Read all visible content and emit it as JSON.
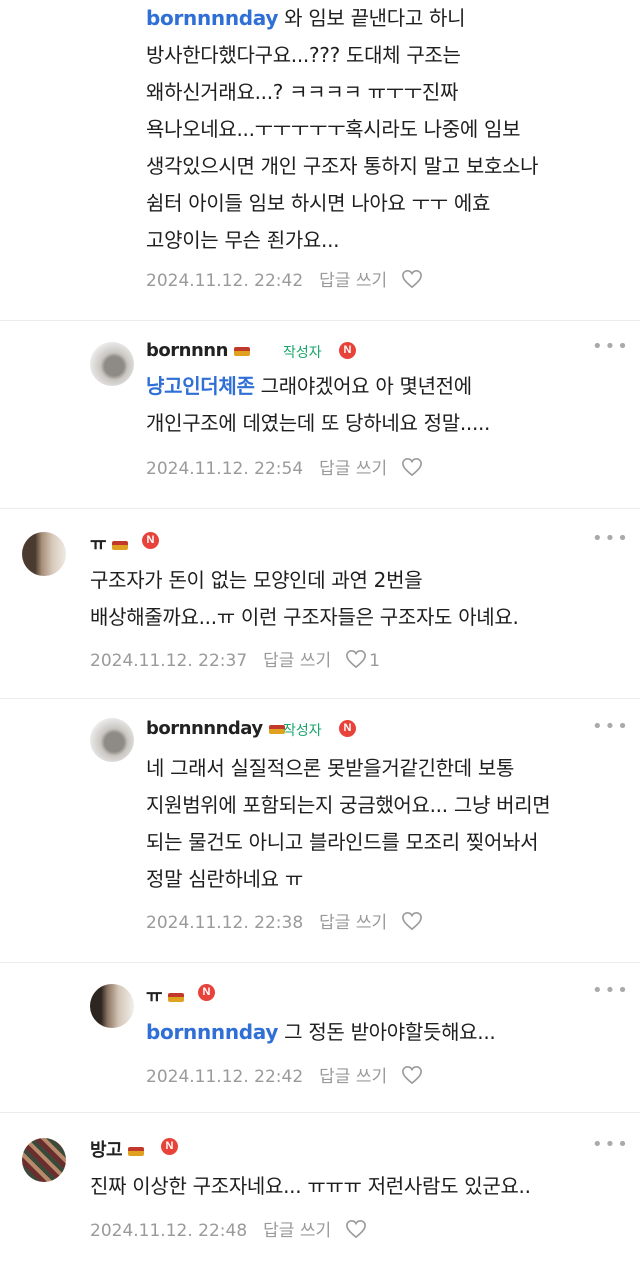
{
  "comments": [
    {
      "id": "c1",
      "mention": "bornnnnday",
      "text_first": " 와 임보 끝낸다고 하니",
      "lines": [
        "방사한다했다구요...??? 도대체 구조는",
        "왜하신거래요...? ㅋㅋㅋㅋ ㅠㅜㅜ진짜",
        "욕나오네요...ㅜㅜㅜㅜㅜ혹시라도 나중에 임보",
        "생각있으시면 개인 구조자 통하지 말고 보호소나",
        "쉼터 아이들 임보 하시면 나아요 ㅜㅜ 에효",
        "고양이는 무슨 죈가요..."
      ],
      "date": "2024.11.12. 22:42",
      "reply": "답글 쓰기",
      "likes": ""
    },
    {
      "id": "c2",
      "name": "bornnnn",
      "author_tag": "작성자",
      "badge": "N",
      "mention": "냥고인더체존",
      "text_first": " 그래야겠어요 아 몇년전에",
      "lines": [
        "개인구조에 데였는데 또 당하네요 정말....."
      ],
      "date": "2024.11.12. 22:54",
      "reply": "답글 쓰기",
      "likes": ""
    },
    {
      "id": "c3",
      "name": "ㅠ",
      "badge": "N",
      "lines": [
        "구조자가 돈이 없는 모양인데 과연 2번을",
        "배상해줄까요...ㅠ 이런 구조자들은 구조자도 아녜요."
      ],
      "date": "2024.11.12. 22:37",
      "reply": "답글 쓰기",
      "likes": "1"
    },
    {
      "id": "c4",
      "name": "bornnnnday",
      "author_tag": "작성자",
      "badge": "N",
      "lines": [
        "네 그래서 실질적으론 못받을거같긴한데 보통",
        "지원범위에 포함되는지 궁금했어요... 그냥 버리면",
        "되는 물건도 아니고 블라인드를 모조리 찢어놔서",
        "정말 심란하네요 ㅠ"
      ],
      "date": "2024.11.12. 22:38",
      "reply": "답글 쓰기",
      "likes": ""
    },
    {
      "id": "c5",
      "name": "ㅠ",
      "badge": "N",
      "mention": "bornnnnday",
      "text_first": " 그 정돈 받아야할듯해요...",
      "lines": [],
      "date": "2024.11.12. 22:42",
      "reply": "답글 쓰기",
      "likes": ""
    },
    {
      "id": "c6",
      "name": "방고",
      "badge": "N",
      "lines": [
        "진짜 이상한 구조자네요... ㅠㅠㅠ 저런사람도 있군요.."
      ],
      "date": "2024.11.12. 22:48",
      "reply": "답글 쓰기",
      "likes": ""
    }
  ],
  "colors": {
    "accent_green": "#1aa56a",
    "badge_red": "#e8433a",
    "mention_blue": "#2f6fd6",
    "meta_gray": "#9a9a9a"
  },
  "icons": {
    "more": "more-dots-icon",
    "like": "heart-outline-icon",
    "badge": "new-badge-icon"
  }
}
